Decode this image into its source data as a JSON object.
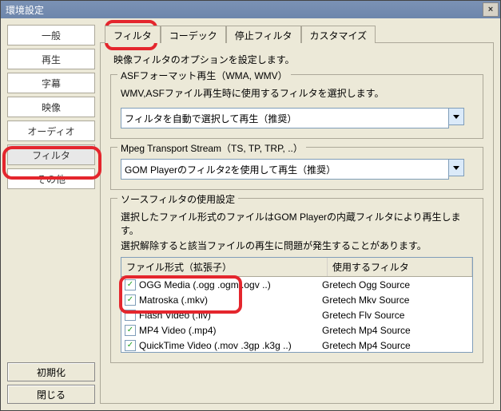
{
  "window": {
    "title": "環境設定"
  },
  "sidebar": {
    "items": [
      {
        "label": "一般"
      },
      {
        "label": "再生"
      },
      {
        "label": "字幕"
      },
      {
        "label": "映像"
      },
      {
        "label": "オーディオ"
      },
      {
        "label": "フィルタ",
        "selected": true
      },
      {
        "label": "その他"
      }
    ],
    "buttons": {
      "reset": "初期化",
      "close": "閉じる"
    }
  },
  "tabs": {
    "items": [
      {
        "label": "フィルタ",
        "active": true
      },
      {
        "label": "コーデック"
      },
      {
        "label": "停止フィルタ"
      },
      {
        "label": "カスタマイズ"
      }
    ]
  },
  "panel": {
    "intro": "映像フィルタのオプションを設定します。",
    "asf": {
      "title": "ASFフォーマット再生（WMA, WMV）",
      "desc": "WMV,ASFファイル再生時に使用するフィルタを選択します。",
      "combo": "フィルタを自動で選択して再生（推奨）"
    },
    "mts": {
      "title": "Mpeg Transport Stream（TS, TP, TRP, ..）",
      "combo": "GOM Playerのフィルタ2を使用して再生（推奨）"
    },
    "source": {
      "title": "ソースフィルタの使用設定",
      "desc1": "選択したファイル形式のファイルはGOM Playerの内蔵フィルタにより再生します。",
      "desc2": "選択解除すると該当ファイルの再生に問題が発生することがあります。",
      "headers": {
        "a": "ファイル形式（拡張子）",
        "b": "使用するフィルタ"
      },
      "rows": [
        {
          "checked": true,
          "name": "OGG Media (.ogg .ogm .ogv ..)",
          "filter": "Gretech Ogg Source"
        },
        {
          "checked": true,
          "name": "Matroska (.mkv)",
          "filter": "Gretech Mkv Source"
        },
        {
          "checked": false,
          "name": "Flash Video (.flv)",
          "filter": "Gretech Flv Source"
        },
        {
          "checked": true,
          "name": "MP4 Video (.mp4)",
          "filter": "Gretech Mp4 Source"
        },
        {
          "checked": true,
          "name": "QuickTime Video (.mov .3gp .k3g ..)",
          "filter": "Gretech Mp4 Source"
        }
      ]
    }
  }
}
